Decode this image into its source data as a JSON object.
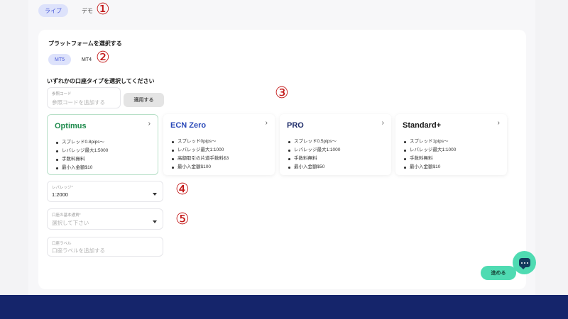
{
  "mode_tabs": {
    "live": "ライブ",
    "demo": "デモ"
  },
  "annotations": [
    "①",
    "②",
    "③",
    "④",
    "⑤"
  ],
  "platform": {
    "heading": "プラットフォームを選択する",
    "tabs": [
      "MT5",
      "MT4"
    ]
  },
  "account_type": {
    "heading": "いずれかの口座タイプを選択してください"
  },
  "referral": {
    "caption": "参照コード",
    "placeholder": "参照コードを追加する",
    "apply_label": "適用する"
  },
  "cards": [
    {
      "title": "Optimus",
      "color": "#1e8a4c",
      "features": [
        "スプレッド0.8pips〜",
        "レバレッジ最大1:5000",
        "手数料無料",
        "最小入金額$10"
      ]
    },
    {
      "title": "ECN Zero",
      "color": "#2a49b8",
      "features": [
        "スプレッド0pips〜",
        "レバレッジ最大1:1000",
        "高額取引の片道手数料$3",
        "最小入金額$100"
      ]
    },
    {
      "title": "PRO",
      "color": "#1f2d6a",
      "features": [
        "スプレッド0.5pips〜",
        "レバレッジ最大1:1000",
        "手数料無料",
        "最小入金額$50"
      ]
    },
    {
      "title": "Standard+",
      "color": "#1a1a1a",
      "features": [
        "スプレッド1pips〜",
        "レバレッジ最大1:1000",
        "手数料無料",
        "最小入金額$10"
      ]
    }
  ],
  "leverage": {
    "caption": "レバレッジ*",
    "value": "1:2000"
  },
  "base_currency": {
    "caption": "口座の基本通貨*",
    "placeholder": "選択して下さい"
  },
  "account_label": {
    "caption": "口座ラベル",
    "placeholder": "口座ラベルを追加する"
  },
  "start_label": "進める",
  "icons": {
    "chevron": "chevron-right-icon",
    "caret": "caret-down-icon",
    "chat": "chat-icon"
  },
  "colors": {
    "accent_tab": "#dde2fb",
    "cta": "#4fdbb2",
    "footer": "#15256b",
    "annotation": "#c31818"
  }
}
